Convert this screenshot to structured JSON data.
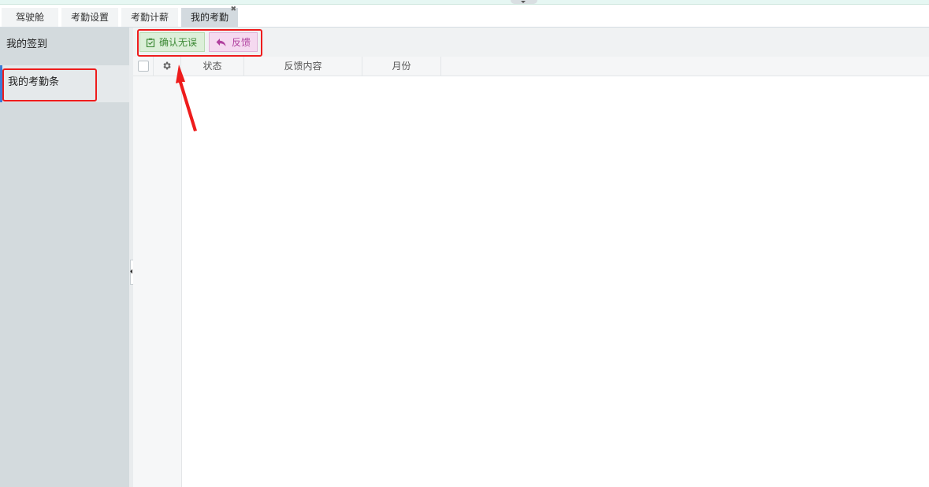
{
  "tabs": [
    {
      "label": "驾驶舱"
    },
    {
      "label": "考勤设置"
    },
    {
      "label": "考勤计薪"
    },
    {
      "label": "我的考勤",
      "active": true
    }
  ],
  "sidebar": {
    "items": [
      {
        "label": "我的签到"
      },
      {
        "label": "我的考勤条",
        "active": true
      }
    ]
  },
  "toolbar": {
    "confirm_label": "确认无误",
    "feedback_label": "反馈"
  },
  "grid": {
    "columns": [
      "状态",
      "反馈内容",
      "月份"
    ]
  },
  "icons": {
    "confirm": "clipboard-check-icon",
    "feedback": "reply-arrow-icon",
    "settings": "gear-icon",
    "tab_close": "close-icon"
  },
  "colors": {
    "sidebar_bg": "#d3dadd",
    "confirm_bg": "#dcefd9",
    "feedback_bg": "#f5d9f0",
    "annotation": "#ee1c1c"
  }
}
